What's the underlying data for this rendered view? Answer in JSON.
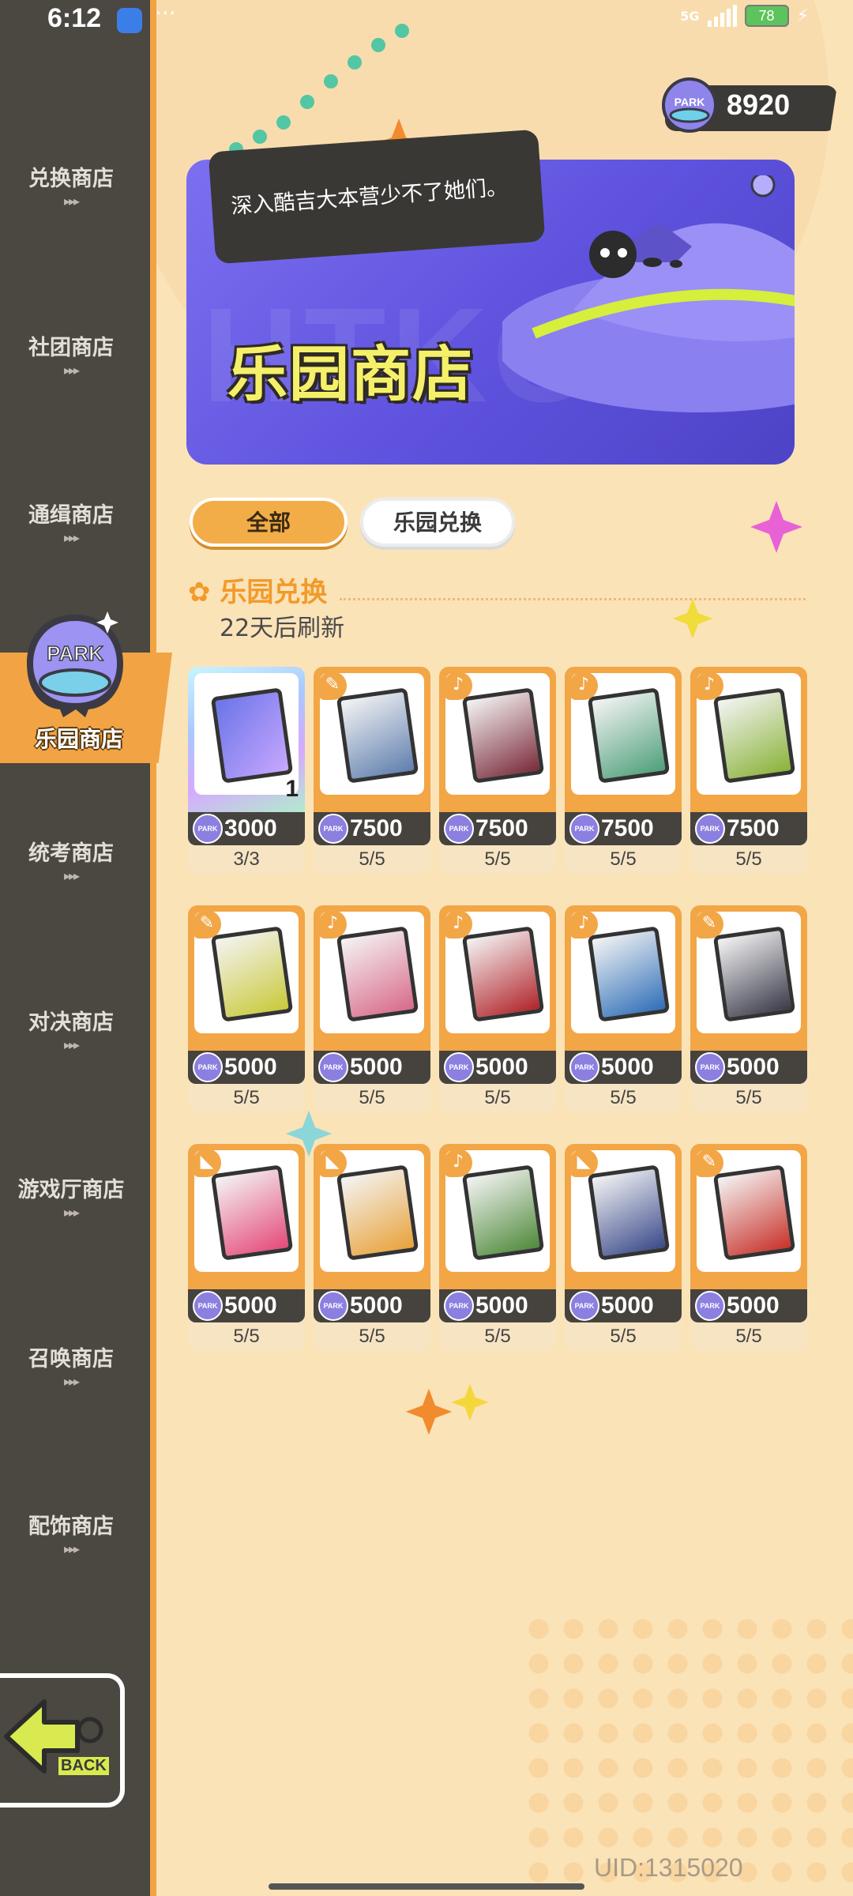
{
  "status_bar": {
    "time": "6:12",
    "more": "···",
    "network": "5G",
    "battery": "78"
  },
  "currency": {
    "icon": "park-coin-icon",
    "value": "8920"
  },
  "sidebar": {
    "items": [
      {
        "label": "兑换商店",
        "arrows": "▸▸▸"
      },
      {
        "label": "社团商店",
        "arrows": "▸▸▸"
      },
      {
        "label": "通缉商店",
        "arrows": "▸▸▸"
      },
      {
        "label": "乐园商店",
        "active": true,
        "emblem_text": "PARK"
      },
      {
        "label": "统考商店",
        "arrows": "▸▸▸"
      },
      {
        "label": "对决商店",
        "arrows": "▸▸▸"
      },
      {
        "label": "游戏厅商店",
        "arrows": "▸▸▸"
      },
      {
        "label": "召唤商店",
        "arrows": "▸▸▸"
      },
      {
        "label": "配饰商店",
        "arrows": "▸▸▸"
      }
    ],
    "back_label": "BACK"
  },
  "banner": {
    "speech": "深入酷吉大本营少不了她们。",
    "title": "乐园商店",
    "bg_text": "HTKO"
  },
  "tabs": [
    {
      "label": "全部",
      "active": true
    },
    {
      "label": "乐园兑换",
      "active": false
    }
  ],
  "section": {
    "title": "乐园兑换",
    "refresh": "22天后刷新"
  },
  "items": [
    {
      "price": "3000",
      "limit": "3/3",
      "quantity": "1",
      "type": "ticket",
      "color": "#6a74e8"
    },
    {
      "price": "7500",
      "limit": "5/5",
      "badge": "✎",
      "color": "#5f7fae"
    },
    {
      "price": "7500",
      "limit": "5/5",
      "badge": "♪",
      "color": "#7a2b3a"
    },
    {
      "price": "7500",
      "limit": "5/5",
      "badge": "♪",
      "color": "#4fa07a"
    },
    {
      "price": "7500",
      "limit": "5/5",
      "badge": "♪",
      "color": "#8ab33a"
    },
    {
      "price": "5000",
      "limit": "5/5",
      "badge": "✎",
      "color": "#c9c93a"
    },
    {
      "price": "5000",
      "limit": "5/5",
      "badge": "♪",
      "color": "#d86a8a"
    },
    {
      "price": "5000",
      "limit": "5/5",
      "badge": "♪",
      "color": "#b0242a"
    },
    {
      "price": "5000",
      "limit": "5/5",
      "badge": "♪",
      "color": "#2f6fb8"
    },
    {
      "price": "5000",
      "limit": "5/5",
      "badge": "✎",
      "color": "#3a3a4a"
    },
    {
      "price": "5000",
      "limit": "5/5",
      "badge": "◣",
      "color": "#e44a7a"
    },
    {
      "price": "5000",
      "limit": "5/5",
      "badge": "◣",
      "color": "#e8a23a"
    },
    {
      "price": "5000",
      "limit": "5/5",
      "badge": "♪",
      "color": "#4f8a3a"
    },
    {
      "price": "5000",
      "limit": "5/5",
      "badge": "◣",
      "color": "#3a4a8a"
    },
    {
      "price": "5000",
      "limit": "5/5",
      "badge": "✎",
      "color": "#c8322a"
    }
  ],
  "price_icon_text": "PARK",
  "uid": "UID:1315020",
  "colors": {
    "accent": "#f2a646",
    "sidebar": "#4b4741",
    "background": "#fbe3b8",
    "banner": "#6458e6"
  }
}
